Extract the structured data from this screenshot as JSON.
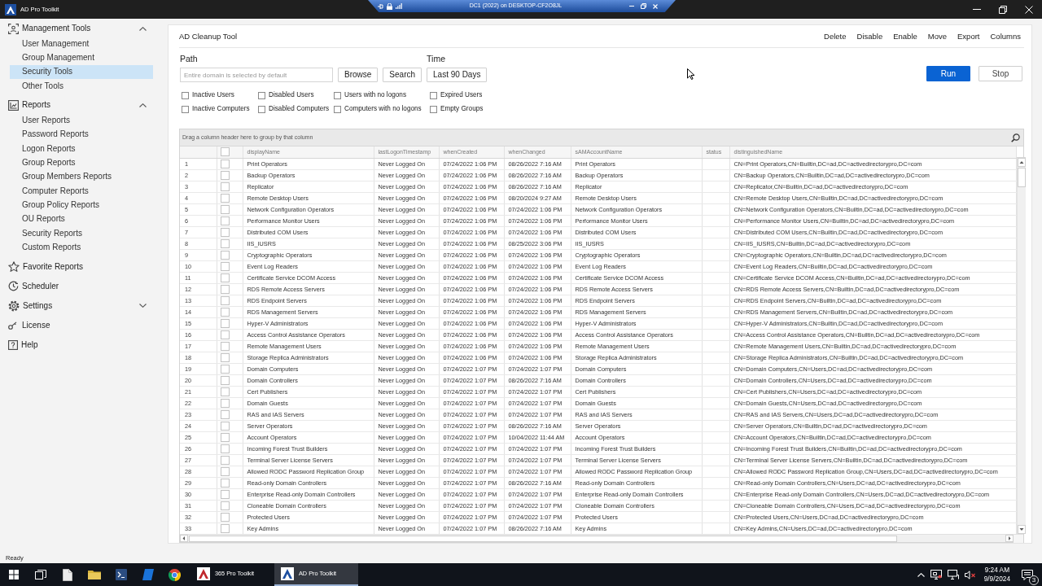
{
  "window": {
    "title": "AD Pro Toolkit"
  },
  "remote_session_bar": {
    "title": "DC1 (2022) on DESKTOP-CF2O8JL"
  },
  "sidebar": {
    "items": [
      {
        "kind": "group",
        "label": "Management Tools",
        "selected": false,
        "expanded": true,
        "children": [
          {
            "label": "User Management",
            "selected": false
          },
          {
            "label": "Group Management",
            "selected": false
          },
          {
            "label": "Security Tools",
            "selected": true
          },
          {
            "label": "Other Tools",
            "selected": false
          }
        ]
      },
      {
        "kind": "group",
        "label": "Reports",
        "selected": false,
        "expanded": true,
        "children": [
          {
            "label": "User Reports",
            "selected": false
          },
          {
            "label": "Password Reports",
            "selected": false
          },
          {
            "label": "Logon Reports",
            "selected": false
          },
          {
            "label": "Group Reports",
            "selected": false
          },
          {
            "label": "Group Members Reports",
            "selected": false
          },
          {
            "label": "Computer Reports",
            "selected": false
          },
          {
            "label": "Group Policy Reports",
            "selected": false
          },
          {
            "label": "OU Reports",
            "selected": false
          },
          {
            "label": "Security Reports",
            "selected": false
          },
          {
            "label": "Custom Reports",
            "selected": false
          }
        ]
      },
      {
        "kind": "link",
        "label": "Favorite Reports",
        "selected": false
      },
      {
        "kind": "link",
        "label": "Scheduler",
        "selected": false
      },
      {
        "kind": "group",
        "label": "Settings",
        "selected": false,
        "expanded": false
      },
      {
        "kind": "link",
        "label": "License",
        "selected": false
      },
      {
        "kind": "link",
        "label": "Help",
        "selected": false
      }
    ]
  },
  "tool": {
    "title": "AD Cleanup Tool",
    "actions": [
      "Delete",
      "Disable",
      "Enable",
      "Move",
      "Export",
      "Columns"
    ]
  },
  "path": {
    "label": "Path",
    "placeholder": "Entire domain is selected by default",
    "buttons": [
      "Browse",
      "Search"
    ]
  },
  "time": {
    "label": "Time",
    "value": "Last 90 Days"
  },
  "run_controls": [
    {
      "kind": "primary",
      "label": "Run"
    },
    {
      "kind": "secondary",
      "label": "Stop"
    }
  ],
  "filters": [
    {
      "label": "Inactive Users",
      "checked": false
    },
    {
      "label": "Disabled Users",
      "checked": false
    },
    {
      "label": "Users with no logons",
      "checked": false
    },
    {
      "label": "Expired Users",
      "checked": false
    },
    {
      "label": "Inactive Computers",
      "checked": false
    },
    {
      "label": "Disabled Computers",
      "checked": false
    },
    {
      "label": "Computers with no logons",
      "checked": false
    },
    {
      "label": "Empty Groups",
      "checked": false
    }
  ],
  "grid": {
    "group_hint": "Drag a column header here to group by that column",
    "header_checked": false,
    "columns": [
      "displayName",
      "lastLogonTimestamp",
      "whenCreated",
      "whenChanged",
      "sAMAccountName",
      "status",
      "distinguishedName"
    ],
    "rows": [
      {
        "number": "1",
        "checked": false,
        "display_name": "Print Operators",
        "last_logon": "Never Logged On",
        "when_created": "07/24/2022 1:06 PM",
        "when_changed": "08/26/2022 7:16 AM",
        "sam_account_name": "Print Operators",
        "distinguished_name": "CN=Print Operators,CN=Builtin,DC=ad,DC=activedirectorypro,DC=com"
      },
      {
        "number": "2",
        "checked": false,
        "display_name": "Backup Operators",
        "last_logon": "Never Logged On",
        "when_created": "07/24/2022 1:06 PM",
        "when_changed": "08/26/2022 7:16 AM",
        "sam_account_name": "Backup Operators",
        "distinguished_name": "CN=Backup Operators,CN=Builtin,DC=ad,DC=activedirectorypro,DC=com"
      },
      {
        "number": "3",
        "checked": false,
        "display_name": "Replicator",
        "last_logon": "Never Logged On",
        "when_created": "07/24/2022 1:06 PM",
        "when_changed": "08/26/2022 7:16 AM",
        "sam_account_name": "Replicator",
        "distinguished_name": "CN=Replicator,CN=Builtin,DC=ad,DC=activedirectorypro,DC=com"
      },
      {
        "number": "4",
        "checked": false,
        "display_name": "Remote Desktop Users",
        "last_logon": "Never Logged On",
        "when_created": "07/24/2022 1:06 PM",
        "when_changed": "08/20/2024 9:27 AM",
        "sam_account_name": "Remote Desktop Users",
        "distinguished_name": "CN=Remote Desktop Users,CN=Builtin,DC=ad,DC=activedirectorypro,DC=com"
      },
      {
        "number": "5",
        "checked": false,
        "display_name": "Network Configuration Operators",
        "last_logon": "Never Logged On",
        "when_created": "07/24/2022 1:06 PM",
        "when_changed": "07/24/2022 1:06 PM",
        "sam_account_name": "Network Configuration Operators",
        "distinguished_name": "CN=Network Configuration Operators,CN=Builtin,DC=ad,DC=activedirectorypro,DC=com"
      },
      {
        "number": "6",
        "checked": false,
        "display_name": "Performance Monitor Users",
        "last_logon": "Never Logged On",
        "when_created": "07/24/2022 1:06 PM",
        "when_changed": "07/24/2022 1:06 PM",
        "sam_account_name": "Performance Monitor Users",
        "distinguished_name": "CN=Performance Monitor Users,CN=Builtin,DC=ad,DC=activedirectorypro,DC=com"
      },
      {
        "number": "7",
        "checked": false,
        "display_name": "Distributed COM Users",
        "last_logon": "Never Logged On",
        "when_created": "07/24/2022 1:06 PM",
        "when_changed": "07/24/2022 1:06 PM",
        "sam_account_name": "Distributed COM Users",
        "distinguished_name": "CN=Distributed COM Users,CN=Builtin,DC=ad,DC=activedirectorypro,DC=com"
      },
      {
        "number": "8",
        "checked": false,
        "display_name": "IIS_IUSRS",
        "last_logon": "Never Logged On",
        "when_created": "07/24/2022 1:06 PM",
        "when_changed": "08/25/2022 3:06 PM",
        "sam_account_name": "IIS_IUSRS",
        "distinguished_name": "CN=IIS_IUSRS,CN=Builtin,DC=ad,DC=activedirectorypro,DC=com"
      },
      {
        "number": "9",
        "checked": false,
        "display_name": "Cryptographic Operators",
        "last_logon": "Never Logged On",
        "when_created": "07/24/2022 1:06 PM",
        "when_changed": "07/24/2022 1:06 PM",
        "sam_account_name": "Cryptographic Operators",
        "distinguished_name": "CN=Cryptographic Operators,CN=Builtin,DC=ad,DC=activedirectorypro,DC=com"
      },
      {
        "number": "10",
        "checked": false,
        "display_name": "Event Log Readers",
        "last_logon": "Never Logged On",
        "when_created": "07/24/2022 1:06 PM",
        "when_changed": "07/24/2022 1:06 PM",
        "sam_account_name": "Event Log Readers",
        "distinguished_name": "CN=Event Log Readers,CN=Builtin,DC=ad,DC=activedirectorypro,DC=com"
      },
      {
        "number": "11",
        "checked": false,
        "display_name": "Certificate Service DCOM Access",
        "last_logon": "Never Logged On",
        "when_created": "07/24/2022 1:06 PM",
        "when_changed": "07/24/2022 1:06 PM",
        "sam_account_name": "Certificate Service DCOM Access",
        "distinguished_name": "CN=Certificate Service DCOM Access,CN=Builtin,DC=ad,DC=activedirectorypro,DC=com"
      },
      {
        "number": "12",
        "checked": false,
        "display_name": "RDS Remote Access Servers",
        "last_logon": "Never Logged On",
        "when_created": "07/24/2022 1:06 PM",
        "when_changed": "07/24/2022 1:06 PM",
        "sam_account_name": "RDS Remote Access Servers",
        "distinguished_name": "CN=RDS Remote Access Servers,CN=Builtin,DC=ad,DC=activedirectorypro,DC=com"
      },
      {
        "number": "13",
        "checked": false,
        "display_name": "RDS Endpoint Servers",
        "last_logon": "Never Logged On",
        "when_created": "07/24/2022 1:06 PM",
        "when_changed": "07/24/2022 1:06 PM",
        "sam_account_name": "RDS Endpoint Servers",
        "distinguished_name": "CN=RDS Endpoint Servers,CN=Builtin,DC=ad,DC=activedirectorypro,DC=com"
      },
      {
        "number": "14",
        "checked": false,
        "display_name": "RDS Management Servers",
        "last_logon": "Never Logged On",
        "when_created": "07/24/2022 1:06 PM",
        "when_changed": "07/24/2022 1:06 PM",
        "sam_account_name": "RDS Management Servers",
        "distinguished_name": "CN=RDS Management Servers,CN=Builtin,DC=ad,DC=activedirectorypro,DC=com"
      },
      {
        "number": "15",
        "checked": false,
        "display_name": "Hyper-V Administrators",
        "last_logon": "Never Logged On",
        "when_created": "07/24/2022 1:06 PM",
        "when_changed": "07/24/2022 1:06 PM",
        "sam_account_name": "Hyper-V Administrators",
        "distinguished_name": "CN=Hyper-V Administrators,CN=Builtin,DC=ad,DC=activedirectorypro,DC=com"
      },
      {
        "number": "16",
        "checked": false,
        "display_name": "Access Control Assistance Operators",
        "last_logon": "Never Logged On",
        "when_created": "07/24/2022 1:06 PM",
        "when_changed": "07/24/2022 1:06 PM",
        "sam_account_name": "Access Control Assistance Operators",
        "distinguished_name": "CN=Access Control Assistance Operators,CN=Builtin,DC=ad,DC=activedirectorypro,DC=com"
      },
      {
        "number": "17",
        "checked": false,
        "display_name": "Remote Management Users",
        "last_logon": "Never Logged On",
        "when_created": "07/24/2022 1:06 PM",
        "when_changed": "07/24/2022 1:06 PM",
        "sam_account_name": "Remote Management Users",
        "distinguished_name": "CN=Remote Management Users,CN=Builtin,DC=ad,DC=activedirectorypro,DC=com"
      },
      {
        "number": "18",
        "checked": false,
        "display_name": "Storage Replica Administrators",
        "last_logon": "Never Logged On",
        "when_created": "07/24/2022 1:06 PM",
        "when_changed": "07/24/2022 1:06 PM",
        "sam_account_name": "Storage Replica Administrators",
        "distinguished_name": "CN=Storage Replica Administrators,CN=Builtin,DC=ad,DC=activedirectorypro,DC=com"
      },
      {
        "number": "19",
        "checked": false,
        "display_name": "Domain Computers",
        "last_logon": "Never Logged On",
        "when_created": "07/24/2022 1:07 PM",
        "when_changed": "07/24/2022 1:07 PM",
        "sam_account_name": "Domain Computers",
        "distinguished_name": "CN=Domain Computers,CN=Users,DC=ad,DC=activedirectorypro,DC=com"
      },
      {
        "number": "20",
        "checked": false,
        "display_name": "Domain Controllers",
        "last_logon": "Never Logged On",
        "when_created": "07/24/2022 1:07 PM",
        "when_changed": "08/26/2022 7:16 AM",
        "sam_account_name": "Domain Controllers",
        "distinguished_name": "CN=Domain Controllers,CN=Users,DC=ad,DC=activedirectorypro,DC=com"
      },
      {
        "number": "21",
        "checked": false,
        "display_name": "Cert Publishers",
        "last_logon": "Never Logged On",
        "when_created": "07/24/2022 1:07 PM",
        "when_changed": "07/24/2022 1:07 PM",
        "sam_account_name": "Cert Publishers",
        "distinguished_name": "CN=Cert Publishers,CN=Users,DC=ad,DC=activedirectorypro,DC=com"
      },
      {
        "number": "22",
        "checked": false,
        "display_name": "Domain Guests",
        "last_logon": "Never Logged On",
        "when_created": "07/24/2022 1:07 PM",
        "when_changed": "07/24/2022 1:07 PM",
        "sam_account_name": "Domain Guests",
        "distinguished_name": "CN=Domain Guests,CN=Users,DC=ad,DC=activedirectorypro,DC=com"
      },
      {
        "number": "23",
        "checked": false,
        "display_name": "RAS and IAS Servers",
        "last_logon": "Never Logged On",
        "when_created": "07/24/2022 1:07 PM",
        "when_changed": "07/24/2022 1:07 PM",
        "sam_account_name": "RAS and IAS Servers",
        "distinguished_name": "CN=RAS and IAS Servers,CN=Users,DC=ad,DC=activedirectorypro,DC=com"
      },
      {
        "number": "24",
        "checked": false,
        "display_name": "Server Operators",
        "last_logon": "Never Logged On",
        "when_created": "07/24/2022 1:07 PM",
        "when_changed": "08/26/2022 7:16 AM",
        "sam_account_name": "Server Operators",
        "distinguished_name": "CN=Server Operators,CN=Builtin,DC=ad,DC=activedirectorypro,DC=com"
      },
      {
        "number": "25",
        "checked": false,
        "display_name": "Account Operators",
        "last_logon": "Never Logged On",
        "when_created": "07/24/2022 1:07 PM",
        "when_changed": "10/04/2022 11:44 AM",
        "sam_account_name": "Account Operators",
        "distinguished_name": "CN=Account Operators,CN=Builtin,DC=ad,DC=activedirectorypro,DC=com"
      },
      {
        "number": "26",
        "checked": false,
        "display_name": "Incoming Forest Trust Builders",
        "last_logon": "Never Logged On",
        "when_created": "07/24/2022 1:07 PM",
        "when_changed": "07/24/2022 1:07 PM",
        "sam_account_name": "Incoming Forest Trust Builders",
        "distinguished_name": "CN=Incoming Forest Trust Builders,CN=Builtin,DC=ad,DC=activedirectorypro,DC=com"
      },
      {
        "number": "27",
        "checked": false,
        "display_name": "Terminal Server License Servers",
        "last_logon": "Never Logged On",
        "when_created": "07/24/2022 1:07 PM",
        "when_changed": "07/24/2022 1:07 PM",
        "sam_account_name": "Terminal Server License Servers",
        "distinguished_name": "CN=Terminal Server License Servers,CN=Builtin,DC=ad,DC=activedirectorypro,DC=com"
      },
      {
        "number": "28",
        "checked": false,
        "display_name": "Allowed RODC Password Replication Group",
        "last_logon": "Never Logged On",
        "when_created": "07/24/2022 1:07 PM",
        "when_changed": "07/24/2022 1:07 PM",
        "sam_account_name": "Allowed RODC Password Replication Group",
        "distinguished_name": "CN=Allowed RODC Password Replication Group,CN=Users,DC=ad,DC=activedirectorypro,DC=com"
      },
      {
        "number": "29",
        "checked": false,
        "display_name": "Read-only Domain Controllers",
        "last_logon": "Never Logged On",
        "when_created": "07/24/2022 1:07 PM",
        "when_changed": "08/26/2022 7:16 AM",
        "sam_account_name": "Read-only Domain Controllers",
        "distinguished_name": "CN=Read-only Domain Controllers,CN=Users,DC=ad,DC=activedirectorypro,DC=com"
      },
      {
        "number": "30",
        "checked": false,
        "display_name": "Enterprise Read-only Domain Controllers",
        "last_logon": "Never Logged On",
        "when_created": "07/24/2022 1:07 PM",
        "when_changed": "07/24/2022 1:07 PM",
        "sam_account_name": "Enterprise Read-only Domain Controllers",
        "distinguished_name": "CN=Enterprise Read-only Domain Controllers,CN=Users,DC=ad,DC=activedirectorypro,DC=com"
      },
      {
        "number": "31",
        "checked": false,
        "display_name": "Cloneable Domain Controllers",
        "last_logon": "Never Logged On",
        "when_created": "07/24/2022 1:07 PM",
        "when_changed": "07/24/2022 1:07 PM",
        "sam_account_name": "Cloneable Domain Controllers",
        "distinguished_name": "CN=Cloneable Domain Controllers,CN=Users,DC=ad,DC=activedirectorypro,DC=com"
      },
      {
        "number": "32",
        "checked": false,
        "display_name": "Protected Users",
        "last_logon": "Never Logged On",
        "when_created": "07/24/2022 1:07 PM",
        "when_changed": "07/24/2022 1:07 PM",
        "sam_account_name": "Protected Users",
        "distinguished_name": "CN=Protected Users,CN=Users,DC=ad,DC=activedirectorypro,DC=com"
      },
      {
        "number": "33",
        "checked": false,
        "display_name": "Key Admins",
        "last_logon": "Never Logged On",
        "when_created": "07/24/2022 1:07 PM",
        "when_changed": "08/26/2022 7:16 AM",
        "sam_account_name": "Key Admins",
        "distinguished_name": "CN=Key Admins,CN=Users,DC=ad,DC=activedirectorypro,DC=com"
      }
    ]
  },
  "status_bar": {
    "text": "Ready"
  },
  "taskbar": {
    "apps": [
      {
        "label": "365 Pro Toolkit",
        "selected": false
      },
      {
        "label": "AD Pro Toolkit",
        "selected": true
      }
    ],
    "time": "9:24 AM",
    "date": "9/9/2024",
    "notification_count": "3"
  }
}
